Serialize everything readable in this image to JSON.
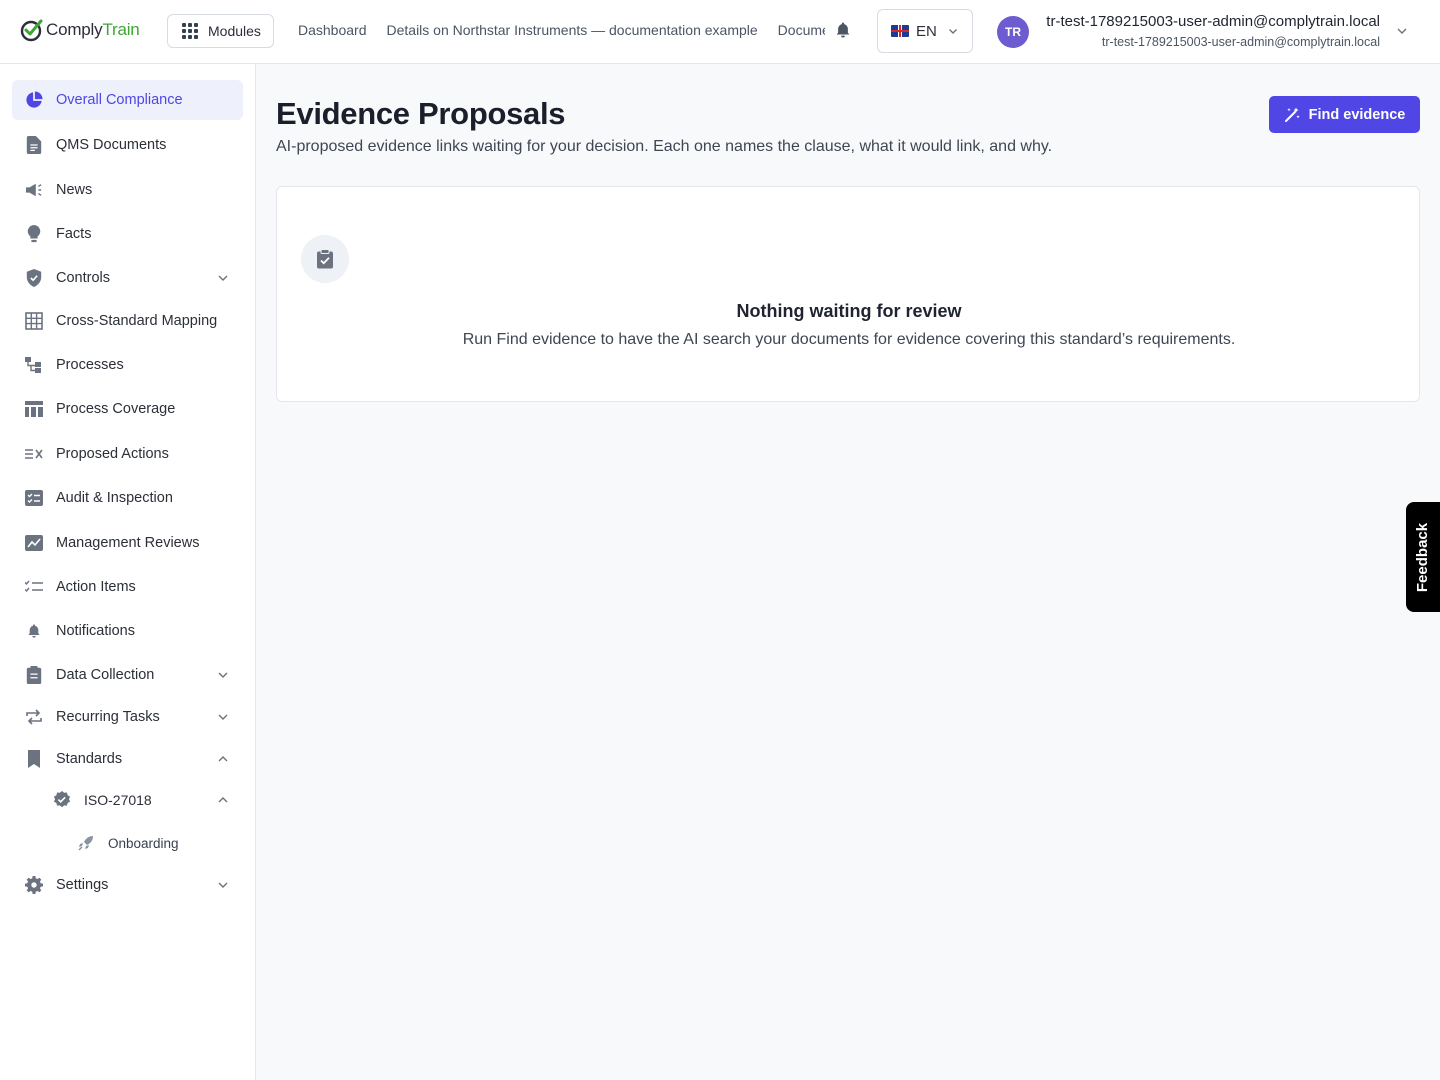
{
  "header": {
    "logo": {
      "part1": "Comply",
      "part2": "Train"
    },
    "modules_label": "Modules",
    "nav": [
      "Dashboard",
      "Details on Northstar Instruments — documentation example",
      "Documents"
    ],
    "language": "EN",
    "user": {
      "initials": "TR",
      "name": "tr-test-1789215003-user-admin@complytrain.local",
      "email": "tr-test-1789215003-user-admin@complytrain.local"
    }
  },
  "sidebar": {
    "items": [
      {
        "label": "Overall Compliance",
        "icon": "pie-chart-icon",
        "active": true
      },
      {
        "label": "QMS Documents",
        "icon": "document-icon"
      },
      {
        "label": "News",
        "icon": "megaphone-icon"
      },
      {
        "label": "Facts",
        "icon": "lightbulb-icon"
      },
      {
        "label": "Controls",
        "icon": "shield-icon",
        "expandable": true
      },
      {
        "label": "Cross-Standard Mapping",
        "icon": "table-grid-icon"
      },
      {
        "label": "Processes",
        "icon": "process-flow-icon"
      },
      {
        "label": "Process Coverage",
        "icon": "coverage-table-icon"
      },
      {
        "label": "Proposed Actions",
        "icon": "proposed-actions-icon"
      },
      {
        "label": "Audit & Inspection",
        "icon": "audit-checklist-icon"
      },
      {
        "label": "Management Reviews",
        "icon": "review-chart-icon"
      },
      {
        "label": "Action Items",
        "icon": "checklist-icon"
      },
      {
        "label": "Notifications",
        "icon": "bell-icon"
      },
      {
        "label": "Data Collection",
        "icon": "clipboard-icon",
        "expandable": true
      },
      {
        "label": "Recurring Tasks",
        "icon": "repeat-icon",
        "expandable": true
      },
      {
        "label": "Standards",
        "icon": "bookmark-icon",
        "expanded": true
      },
      {
        "label": "ISO-27018",
        "icon": "verified-badge-icon",
        "expanded": true
      },
      {
        "label": "Onboarding",
        "icon": "rocket-icon"
      },
      {
        "label": "Settings",
        "icon": "gear-icon",
        "expandable": true
      }
    ]
  },
  "main": {
    "title": "Evidence Proposals",
    "subtitle": "AI-proposed evidence links waiting for your decision. Each one names the clause, what it would link, and why.",
    "find_button": "Find evidence",
    "empty": {
      "title": "Nothing waiting for review",
      "description": "Run Find evidence to have the AI search your documents for evidence covering this standard’s requirements."
    }
  },
  "feedback_label": "Feedback",
  "colors": {
    "accent": "#4f46e5",
    "brand_green": "#3fa535"
  }
}
